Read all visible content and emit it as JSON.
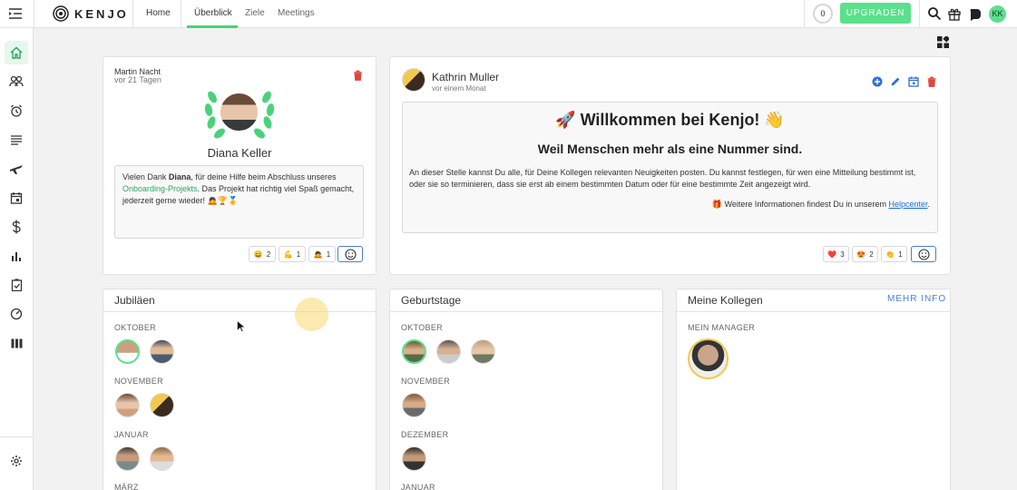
{
  "topbar": {
    "logo_text": "KENJO",
    "home": "Home",
    "tabs": [
      "Überblick",
      "Ziele",
      "Meetings"
    ],
    "active_tab": "Überblick",
    "counter": "0",
    "upgrade": "UPGRADEN",
    "user_initials": "KK"
  },
  "colors": {
    "accent": "#5be08b",
    "link": "#4a7fd0",
    "delete": "#e0443a"
  },
  "post1": {
    "author": "Martin Nacht",
    "time": "vor 21 Tagen",
    "recipient": "Diana Keller",
    "text_before": "Vielen Dank ",
    "text_bold": "Diana",
    "text_mid": ", für deine Hilfe beim Abschluss unseres ",
    "text_link": "Onboarding-Projekts",
    "text_after": ". Das Projekt hat richtig viel Spaß gemacht, jederzeit gerne wieder! 🙇🏆🥇",
    "reactions": [
      {
        "emoji": "😄",
        "count": "2"
      },
      {
        "emoji": "💪",
        "count": "1"
      },
      {
        "emoji": "🙇",
        "count": "1"
      }
    ]
  },
  "post2": {
    "author": "Kathrin Muller",
    "time": "vor einem Monat",
    "title": "🚀 Willkommen bei Kenjo! 👋",
    "subtitle": "Weil Menschen mehr als eine Nummer sind.",
    "body": "An dieser Stelle kannst Du alle, für Deine Kollegen relevanten Neuigkeiten posten. Du kannst festlegen, für wen eine Mitteilung bestimmt ist, oder sie so terminieren, dass sie erst ab einem bestimmten Datum oder für eine bestimmte Zeit angezeigt wird.",
    "help_prefix": "🎁 Weitere Informationen findest Du in unserem ",
    "help_link": "Helpcenter",
    "help_suffix": ".",
    "reactions": [
      {
        "emoji": "❤️",
        "count": "3"
      },
      {
        "emoji": "😍",
        "count": "2"
      },
      {
        "emoji": "👏",
        "count": "1"
      }
    ]
  },
  "jubilaeen": {
    "title": "Jubiläen",
    "months": [
      "OKTOBER",
      "NOVEMBER",
      "JANUAR",
      "MÄRZ"
    ]
  },
  "geburtstage": {
    "title": "Geburtstage",
    "months": [
      "OKTOBER",
      "NOVEMBER",
      "DEZEMBER",
      "JANUAR"
    ]
  },
  "kollegen": {
    "title": "Meine Kollegen",
    "more": "MEHR INFO",
    "manager_label": "MEIN MANAGER"
  }
}
